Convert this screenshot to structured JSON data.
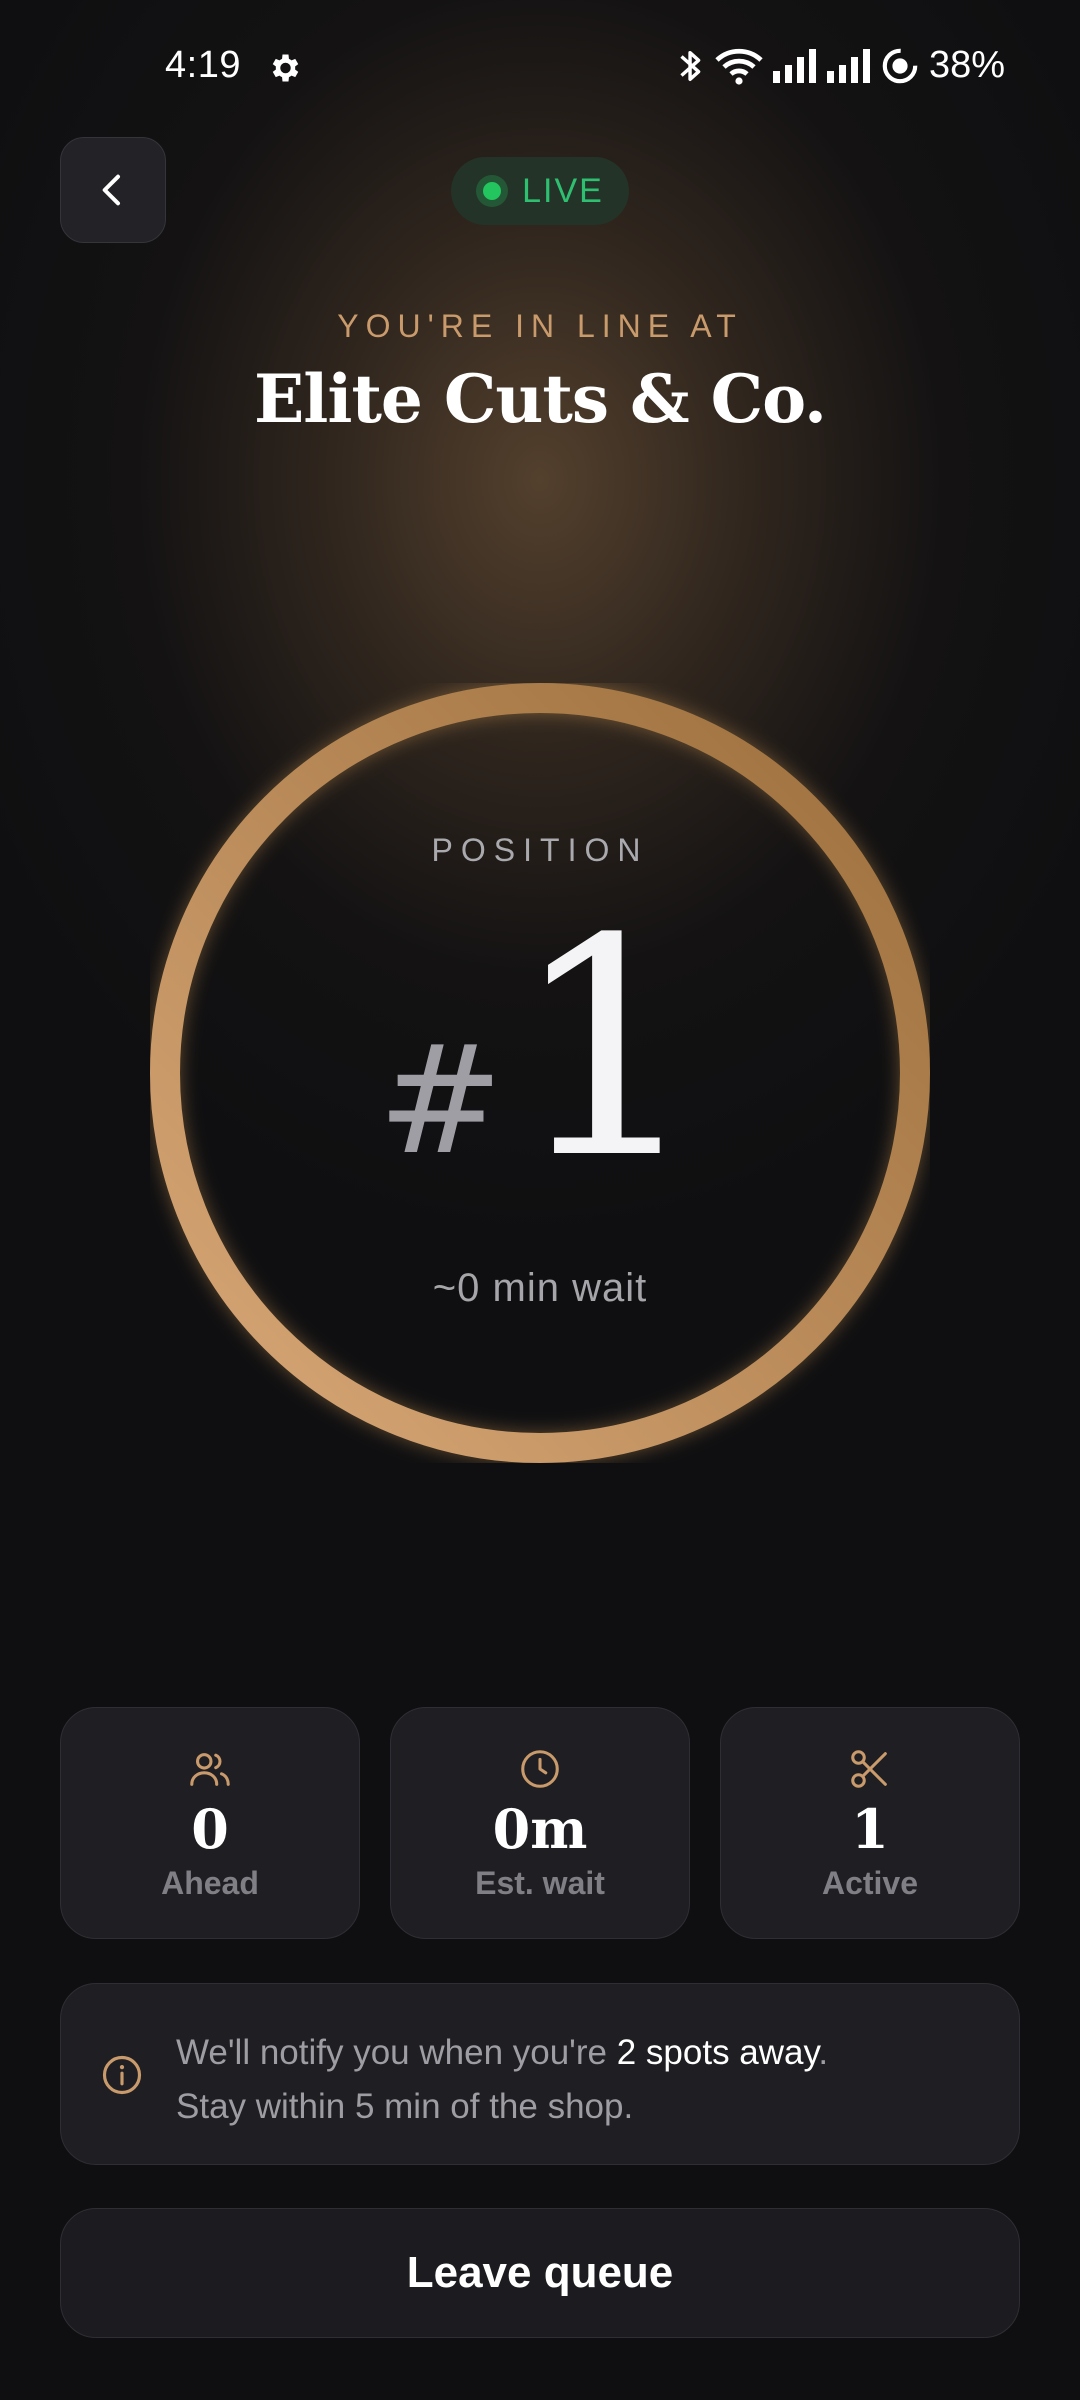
{
  "status_bar": {
    "time": "4:19",
    "battery": "38%",
    "icons": [
      "settings-gear-icon",
      "bluetooth-icon",
      "wifi-icon",
      "signal-icon",
      "signal-icon",
      "data-saver-icon"
    ]
  },
  "header": {
    "back_icon": "chevron-left-icon",
    "live_label": "LIVE",
    "subtitle": "YOU'RE IN LINE AT",
    "shop_name": "Elite Cuts & Co."
  },
  "queue": {
    "label": "POSITION",
    "hash": "#",
    "position": "1",
    "wait": "~0 min wait",
    "ring_progress": 1.0
  },
  "stats": [
    {
      "icon": "users-icon",
      "value": "0",
      "label": "Ahead"
    },
    {
      "icon": "clock-icon",
      "value": "0m",
      "label": "Est. wait"
    },
    {
      "icon": "scissors-icon",
      "value": "1",
      "label": "Active"
    }
  ],
  "info": {
    "icon": "info-icon",
    "text_before": "We'll notify you when you're ",
    "highlight": "2 spots away",
    "text_after": ".",
    "line2": "Stay within 5 min of the shop."
  },
  "actions": {
    "leave_label": "Leave queue"
  },
  "colors": {
    "accent_gold": "#c99a6b",
    "live_green": "#22c55e",
    "background": "#0f0f11",
    "card": "#1f1f23"
  }
}
